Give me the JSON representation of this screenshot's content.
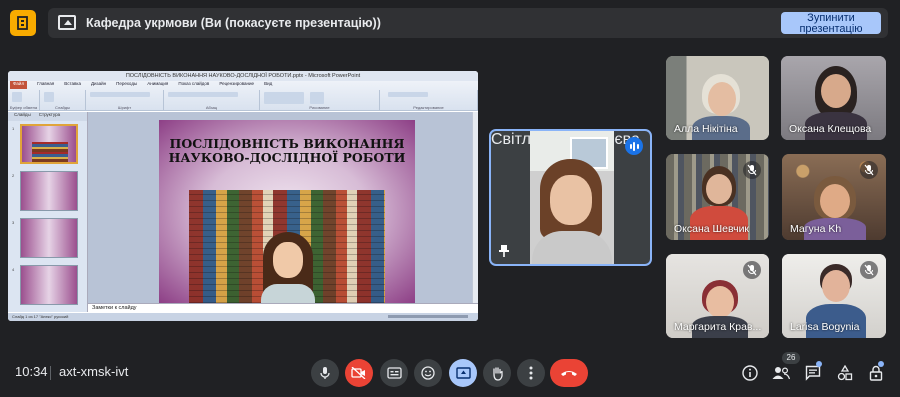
{
  "meeting": {
    "presenting_banner": "Кафедра укрмови (Ви (покасуєте презентацію))",
    "stop_button": "Зупинити презентацію",
    "clock": "10:34",
    "meeting_code": "axt-xmsk-ivt",
    "participant_count": "26"
  },
  "presentation": {
    "window_title": "ПОСЛІДОВНІСТЬ ВИКОНАННЯ НАУКОВО-ДОСЛІДНОЇ РОБОТИ.pptx - Microsoft PowerPoint",
    "tabs": [
      "Файл",
      "Главная",
      "Вставка",
      "Дизайн",
      "Переходы",
      "Анимация",
      "Показ слайдов",
      "Рецензирование",
      "Вид"
    ],
    "groups": [
      "Буфер обмена",
      "Слайды",
      "Шрифт",
      "Абзац",
      "Рисование",
      "Редактирование"
    ],
    "panel_tabs": [
      "Слайды",
      "Структура"
    ],
    "slide_numbers": [
      "1",
      "2",
      "3",
      "4"
    ],
    "slide_title": "ПОСЛІДОВНІСТЬ ВИКОНАННЯ НАУКОВО-ДОСЛІДНОЇ РОБОТИ",
    "notes_placeholder": "Заметки к слайду",
    "status_bar": "Слайд 1 из 17    \"Апекс\"    русский"
  },
  "speaker": {
    "name": "Світлана Негодяєва"
  },
  "participants": [
    {
      "name": "Алла Нікітіна",
      "muted": false
    },
    {
      "name": "Оксана Клещова",
      "muted": false
    },
    {
      "name": "Оксана Шевчик",
      "muted": true
    },
    {
      "name": "Магуна Kh",
      "muted": true
    },
    {
      "name": "Маргарита Крав...",
      "muted": true
    },
    {
      "name": "Larisa Bogynia",
      "muted": true
    }
  ],
  "icons": {
    "app": "google-meet-folder-icon",
    "mic": "microphone-icon",
    "camera": "camera-off-icon",
    "captions": "closed-captions-icon",
    "emoji": "emoji-icon",
    "present": "present-screen-icon",
    "hand": "raise-hand-icon",
    "more": "more-options-icon",
    "end": "end-call-icon",
    "info": "meeting-details-icon",
    "people": "people-icon",
    "chat": "chat-icon",
    "activities": "activities-icon",
    "host": "host-controls-icon"
  },
  "colors": {
    "background": "#202124",
    "accent": "#8ab4f8",
    "stop_button": "#a8c7fa",
    "danger": "#ea4335"
  }
}
